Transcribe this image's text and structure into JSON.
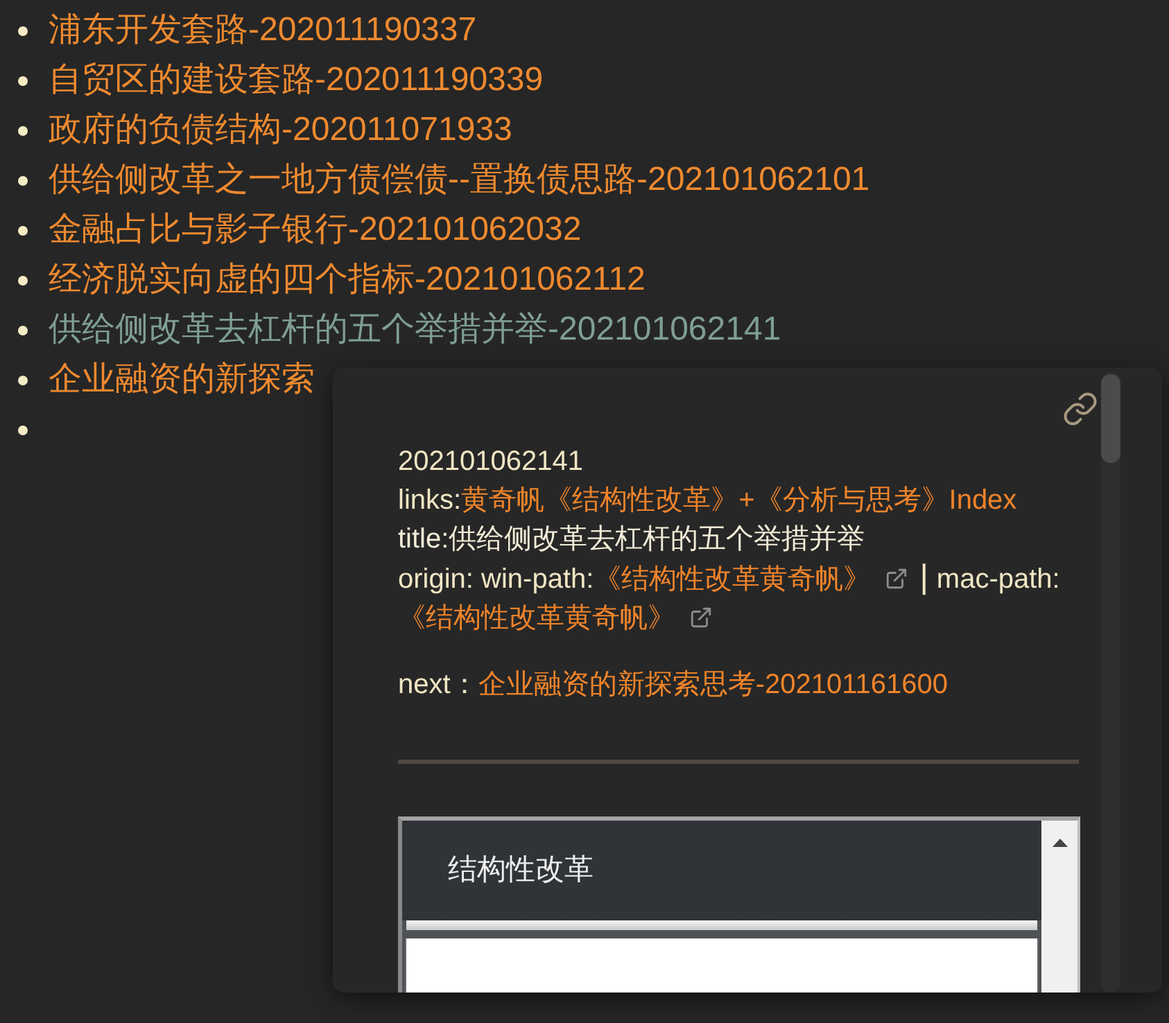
{
  "list": [
    {
      "kind": "link",
      "text": "浦东开发套路-202011190337",
      "hovered": false
    },
    {
      "kind": "link",
      "text": "自贸区的建设套路-202011190339",
      "hovered": false
    },
    {
      "kind": "link",
      "text": "政府的负债结构-202011071933",
      "hovered": false
    },
    {
      "kind": "link",
      "text": "供给侧改革之一地方债偿债--置换债思路-202101062101",
      "hovered": false
    },
    {
      "kind": "link",
      "text": "金融占比与影子银行-202101062032",
      "hovered": false
    },
    {
      "kind": "link",
      "text": "经济脱实向虚的四个指标-202101062112",
      "hovered": false
    },
    {
      "kind": "link",
      "text": "供给侧改革去杠杆的五个举措并举-202101062141",
      "hovered": true
    },
    {
      "kind": "link",
      "text": "企业融资的新探索",
      "hovered": false
    },
    {
      "kind": "empty"
    }
  ],
  "preview": {
    "note_id": "202101062141",
    "links": {
      "label": "links:",
      "link": "黄奇帆《结构性改革》+《分析与思考》Index"
    },
    "title": "title:供给侧改革去杠杆的五个举措并举",
    "origin": {
      "label": "origin: win-path:",
      "win_link": "《结构性改革黄奇帆》",
      "separator": "|",
      "mac_label": "mac-path:",
      "mac_link": "《结构性改革黄奇帆》"
    },
    "next": {
      "label": "next：",
      "link": "企业融资的新探索思考-202101161600"
    },
    "embed": {
      "title": "结构性改革"
    }
  }
}
